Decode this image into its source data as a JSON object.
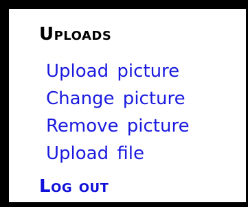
{
  "colors": {
    "background": "#000000",
    "panel": "#ffffff",
    "heading": "#000000",
    "link": "#1a1adf",
    "logout": "#1010d8"
  },
  "uploads": {
    "heading": "Uploads",
    "items": [
      {
        "label": "Upload picture"
      },
      {
        "label": "Change picture"
      },
      {
        "label": "Remove picture"
      },
      {
        "label": "Upload file"
      }
    ]
  },
  "logout": {
    "label": "Log out"
  }
}
